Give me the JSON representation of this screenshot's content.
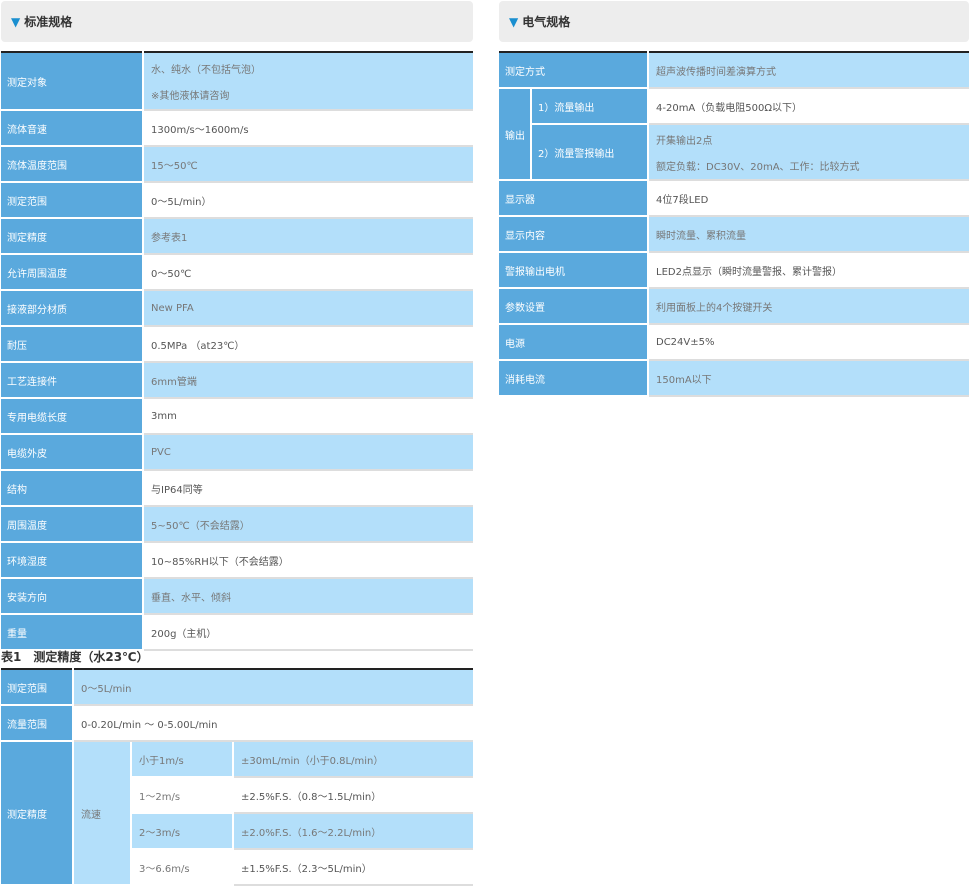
{
  "standard": {
    "title": "标准规格",
    "rows": [
      {
        "label": "测定对象",
        "value": "水、纯水（不包括气泡）",
        "value2": "※其他液体请咨询"
      },
      {
        "label": "流体音速",
        "value": "1300m/s〜1600m/s"
      },
      {
        "label": "流体温度范围",
        "value": "15〜50℃"
      },
      {
        "label": "测定范围",
        "value": "0〜5L/min）"
      },
      {
        "label": "测定精度",
        "value": "参考表1"
      },
      {
        "label": "允许周围温度",
        "value": "0〜50℃"
      },
      {
        "label": "接液部分材质",
        "value": "New PFA"
      },
      {
        "label": "耐压",
        "value": "0.5MPa （at23℃）"
      },
      {
        "label": "工艺连接件",
        "value": "6mm管端"
      },
      {
        "label": "专用电缆长度",
        "value": "3mm"
      },
      {
        "label": "电缆外皮",
        "value": "PVC"
      },
      {
        "label": "结构",
        "value": "与IP64同等"
      },
      {
        "label": "周围温度",
        "value": "5~50℃（不会结露）"
      },
      {
        "label": "环境湿度",
        "value": "10~85%RH以下（不会结露）"
      },
      {
        "label": "安装方向",
        "value": "垂直、水平、倾斜"
      },
      {
        "label": "重量",
        "value": "200g（主机）"
      }
    ]
  },
  "electrical": {
    "title": "电气规格",
    "method": {
      "label": "测定方式",
      "value": "超声波传播时间差演算方式"
    },
    "output": {
      "label": "输出",
      "sub1": {
        "label": "1）流量输出",
        "value": "4-20mA（负载电阻500Ω以下）"
      },
      "sub2": {
        "label": "2）流量警报输出",
        "value": "开集输出2点",
        "value2": "额定负载：DC30V、20mA、工作：比较方式"
      }
    },
    "rows": [
      {
        "label": "显示器",
        "value": "4位7段LED"
      },
      {
        "label": "显示内容",
        "value": "瞬时流量、累积流量"
      },
      {
        "label": "警报输出电机",
        "value": "LED2点显示（瞬时流量警报、累计警报）"
      },
      {
        "label": "参数设置",
        "value": "利用面板上的4个按键开关"
      },
      {
        "label": "电源",
        "value": "DC24V±5%"
      },
      {
        "label": "消耗电流",
        "value": "150mA以下"
      }
    ]
  },
  "accuracy": {
    "caption": "表1　测定精度（水23℃）",
    "range": {
      "label": "测定范围",
      "value": "0〜5L/min"
    },
    "flow_range": {
      "label": "流量范围",
      "value": "0-0.20L/min 〜 0-5.00L/min"
    },
    "precision": {
      "label": "测定精度",
      "sub_label": "流速",
      "rows": [
        {
          "speed": "小于1m/s",
          "value": "±30mL/min（小于0.8L/min）"
        },
        {
          "speed": "1〜2m/s",
          "value": "±2.5%F.S.（0.8〜1.5L/min）"
        },
        {
          "speed": "2〜3m/s",
          "value": "±2.0%F.S.（1.6〜2.2L/min）"
        },
        {
          "speed": "3〜6.6m/s",
          "value": "±1.5%F.S.（2.3〜5L/min）"
        }
      ]
    }
  }
}
